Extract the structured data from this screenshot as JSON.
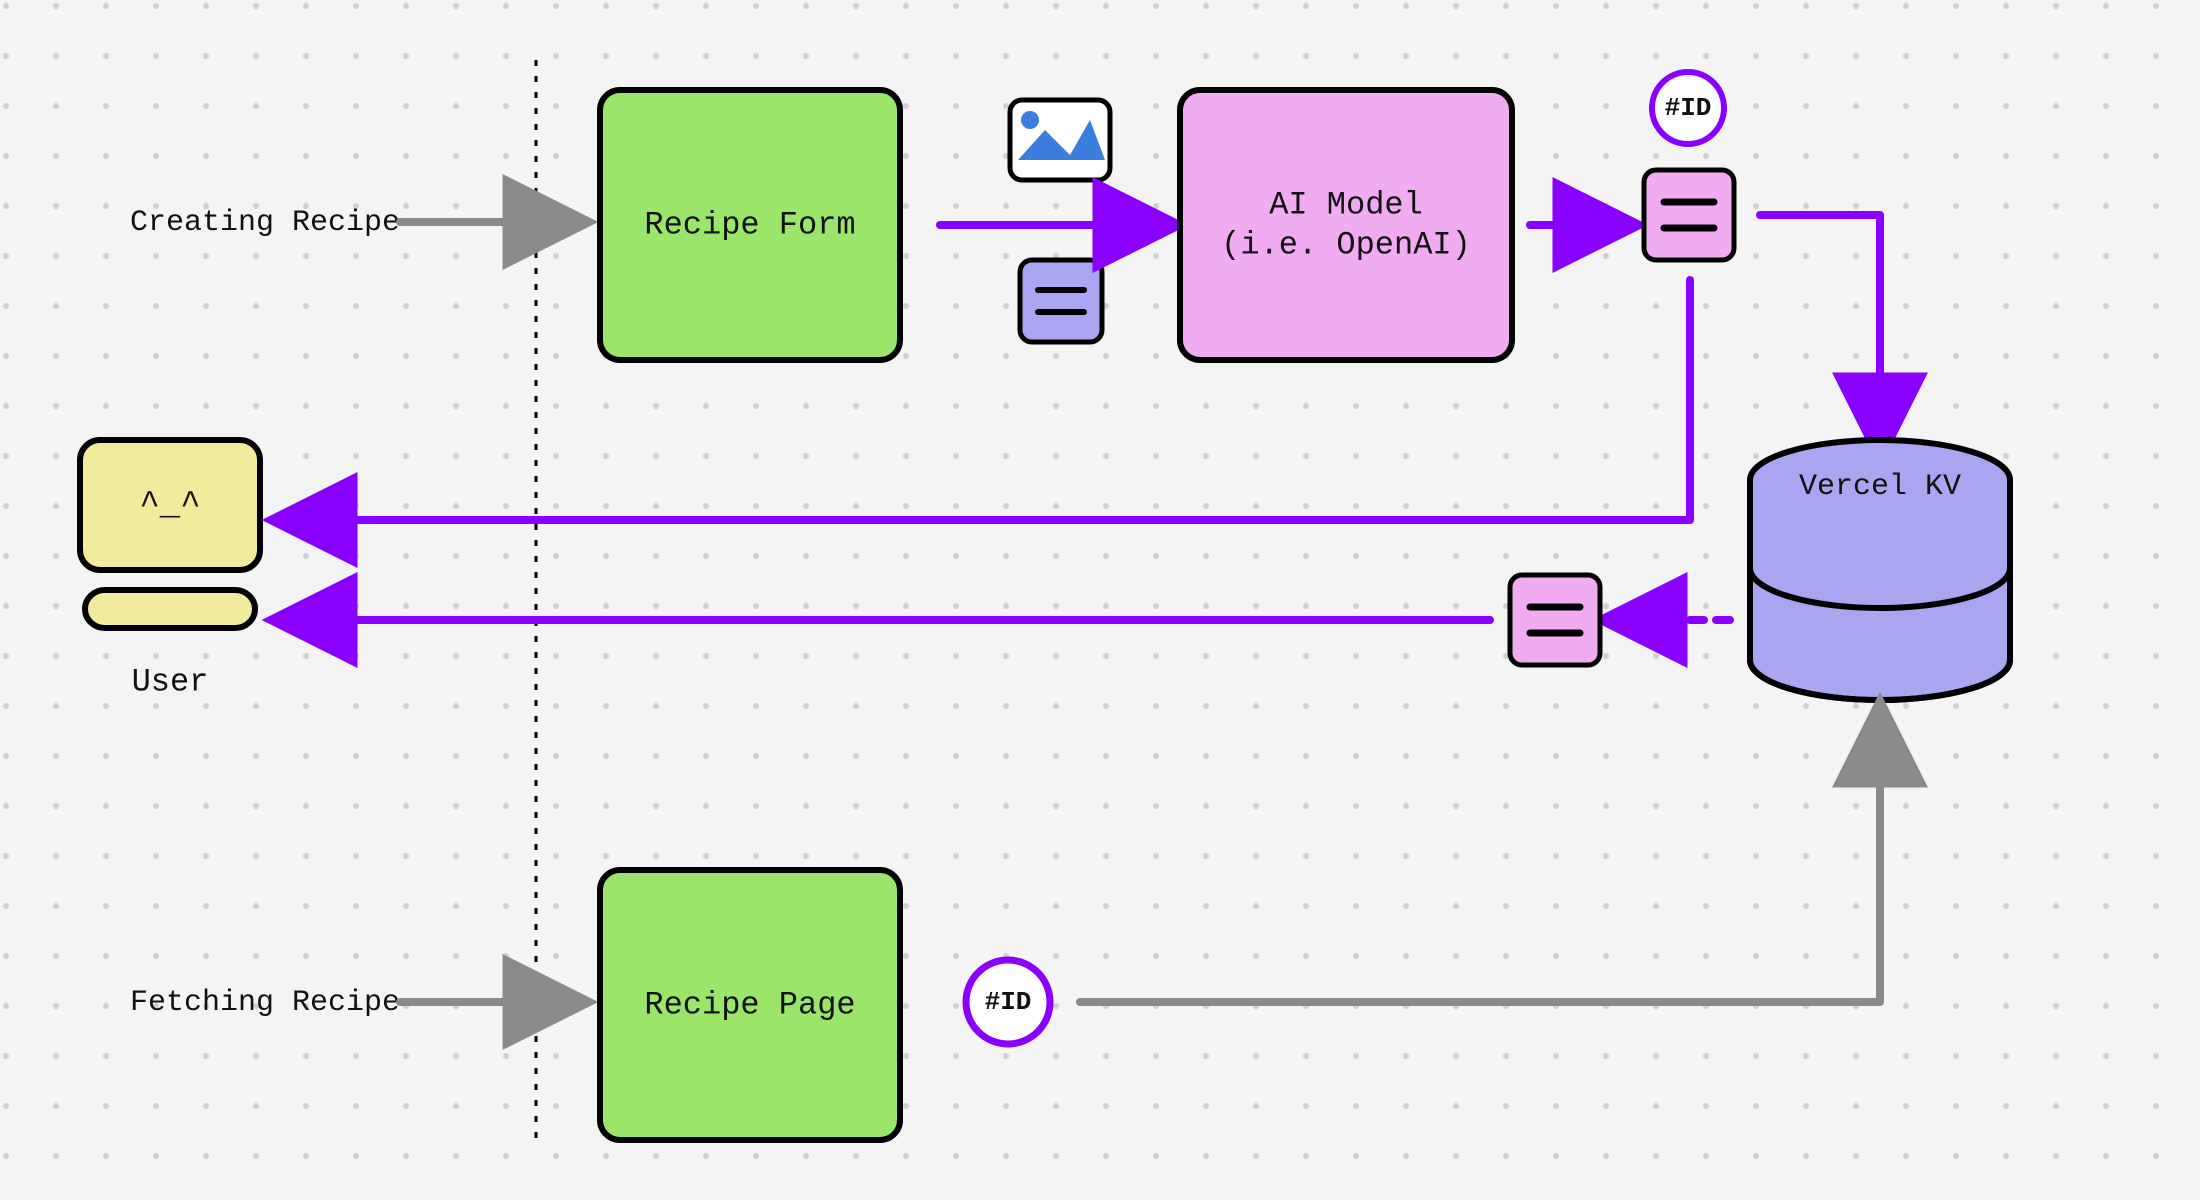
{
  "nodes": {
    "user": "User",
    "recipe_form": "Recipe Form",
    "ai_model_line1": "AI Model",
    "ai_model_line2": "(i.e. OpenAI)",
    "recipe_page": "Recipe Page",
    "vercel_kv": "Vercel KV"
  },
  "tags": {
    "id_top": "#ID",
    "id_bottom": "#ID"
  },
  "flows": {
    "creating": "Creating Recipe",
    "fetching": "Fetching Recipe"
  },
  "colors": {
    "purple": "#8a00ff",
    "gray": "#8a8a8a",
    "green": "#9be56b",
    "pink": "#f1abf1",
    "lavender": "#a9a5f1",
    "yellow": "#f1eb9b"
  }
}
